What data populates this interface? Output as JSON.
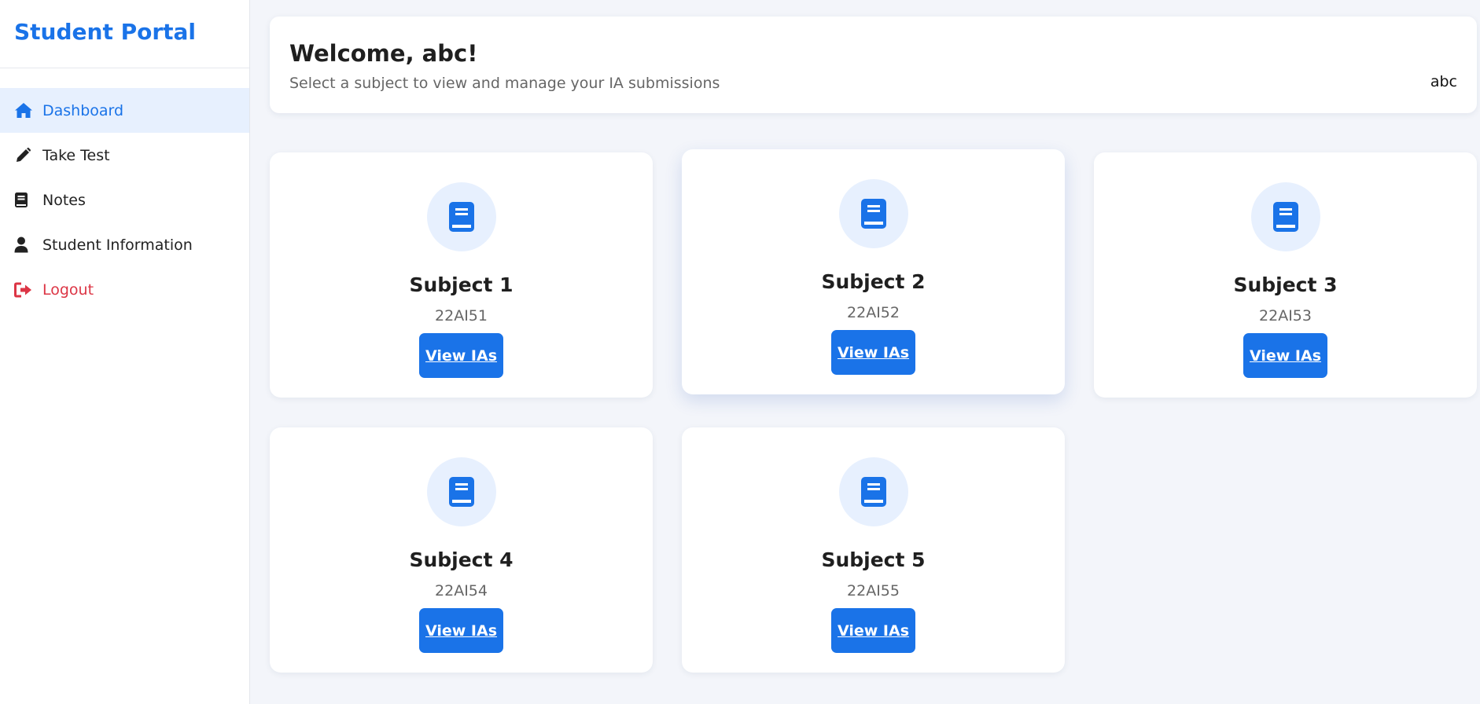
{
  "brand": {
    "title": "Student Portal",
    "color": "#1a73e8"
  },
  "nav": [
    {
      "label": "Dashboard",
      "icon": "home-icon",
      "active": true
    },
    {
      "label": "Take Test",
      "icon": "pencil-icon"
    },
    {
      "label": "Notes",
      "icon": "book-icon"
    },
    {
      "label": "Student Information",
      "icon": "user-icon"
    },
    {
      "label": "Logout",
      "icon": "sign-out-icon",
      "color": "#dc3545"
    }
  ],
  "header": {
    "title": "Welcome, abc!",
    "subtitle": "Select a subject to view and manage your IA submissions",
    "user": "abc"
  },
  "subjects": [
    {
      "name": "Subject 1",
      "code": "22AI51",
      "button": "View IAs",
      "icon": "book-icon"
    },
    {
      "name": "Subject 2",
      "code": "22AI52",
      "button": "View IAs",
      "icon": "book-icon"
    },
    {
      "name": "Subject 3",
      "code": "22AI53",
      "button": "View IAs",
      "icon": "book-icon"
    },
    {
      "name": "Subject 4",
      "code": "22AI54",
      "button": "View IAs",
      "icon": "book-icon"
    },
    {
      "name": "Subject 5",
      "code": "22AI55",
      "button": "View IAs",
      "icon": "book-icon"
    }
  ],
  "colors": {
    "accent": "#1a73e8",
    "background": "#f3f5fa",
    "danger": "#dc3545"
  }
}
